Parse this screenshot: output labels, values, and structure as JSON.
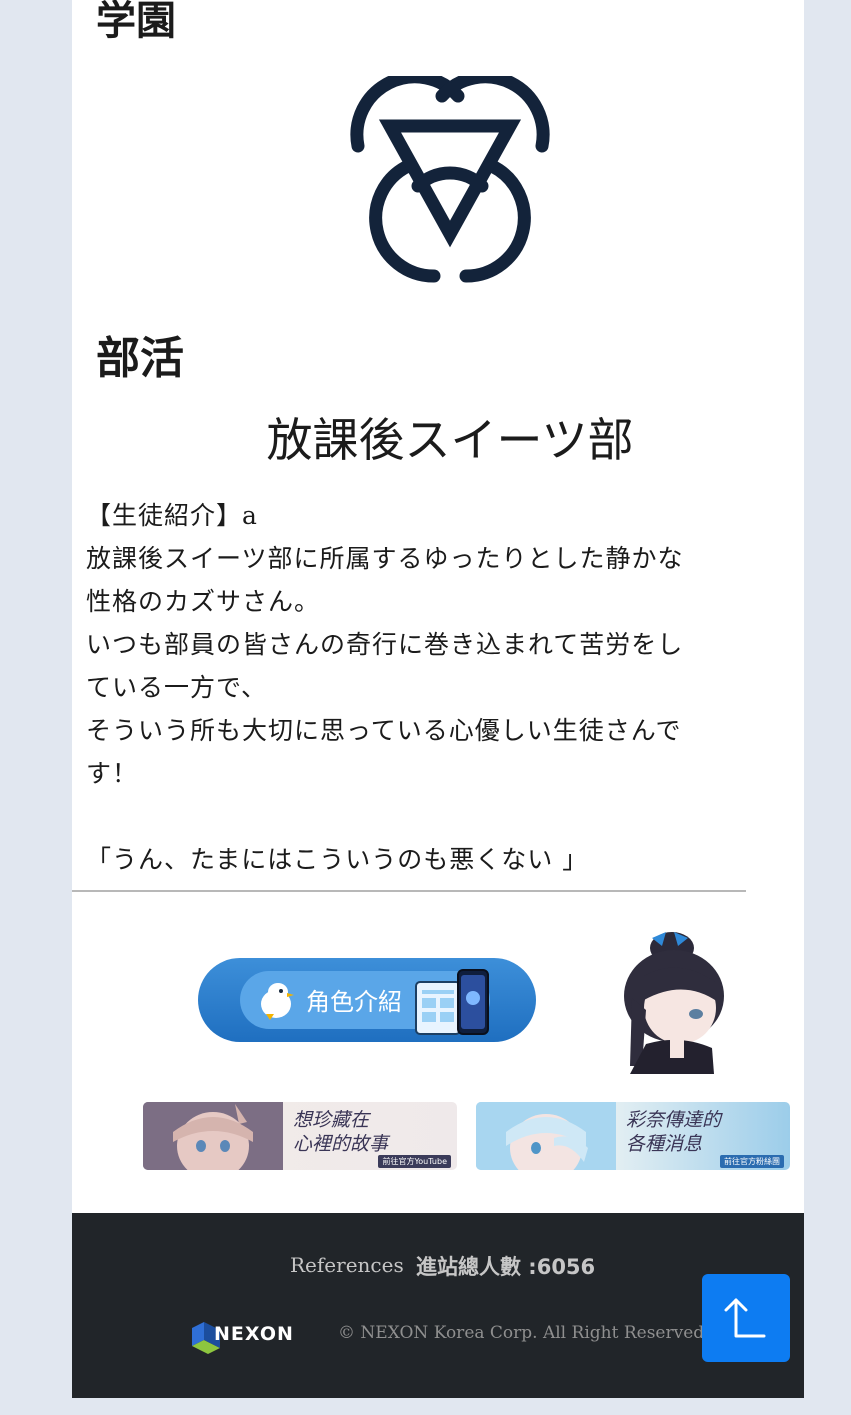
{
  "school": {
    "heading": "学園"
  },
  "club": {
    "heading": "部活",
    "name": "放課後スイーツ部"
  },
  "intro": {
    "lines": [
      "【生徒紹介】a",
      "放課後スイーツ部に所属するゆったりとした静かな",
      "性格のカズサさん。",
      "いつも部員の皆さんの奇行に巻き込まれて苦労をし",
      "ている一方で、",
      "そういう所も大切に思っている心優しい生徒さんで",
      "す！"
    ],
    "quote": "「うん、たまにはこういうのも悪くない 」"
  },
  "links": {
    "character_button": "角色介紹",
    "banner_youtube_caption_1": "想珍藏在",
    "banner_youtube_caption_2": "心裡的故事",
    "banner_youtube_tag": "前往官方YouTube",
    "banner_facebook_caption_1": "彩奈傳達的",
    "banner_facebook_caption_2": "各種消息",
    "banner_facebook_tag": "前往官方粉絲團"
  },
  "footer": {
    "references": "References",
    "visits": "進站總人數 :6056",
    "logo_text": "NEXON",
    "copyright": "© NEXON Korea Corp. All Right Reserved."
  },
  "colors": {
    "accent": "#0d7cf2",
    "footer_bg": "#212529",
    "emblem": "#13233a"
  },
  "icons": {
    "back_to_top": "arrow-up-icon"
  }
}
